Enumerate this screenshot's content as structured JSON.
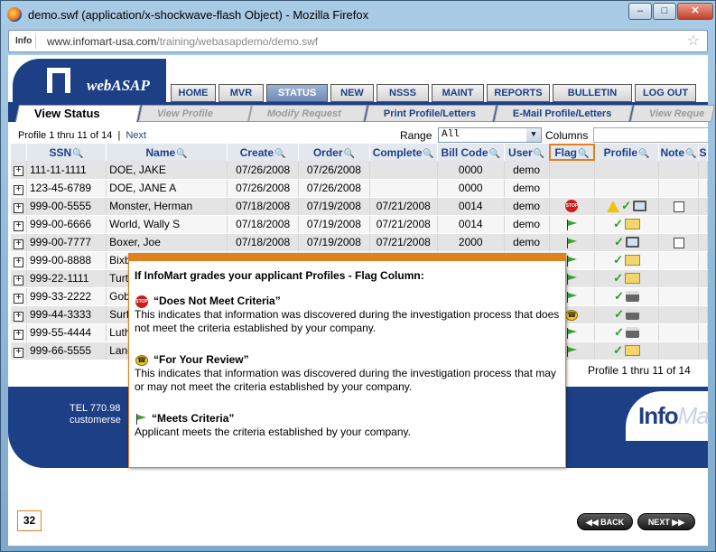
{
  "window": {
    "title": "demo.swf (application/x-shockwave-flash Object) - Mozilla Firefox"
  },
  "address": {
    "badge": "Info",
    "domain": "www.infomart-usa.com",
    "path": "/training/webasapdemo/demo.swf"
  },
  "logo": {
    "text": "webASAP"
  },
  "nav": [
    "HOME",
    "MVR",
    "STATUS",
    "NEW",
    "NSSS",
    "MAINT",
    "REPORTS",
    "BULLETIN",
    "LOG OUT"
  ],
  "tabs": [
    "View Status",
    "View Profile",
    "Modify Request",
    "Print Profile/Letters",
    "E-Mail Profile/Letters",
    "View Reque"
  ],
  "infobar": {
    "summary": "Profile 1 thru 11 of 14",
    "next": "Next",
    "range_label": "Range",
    "range_value": "All",
    "columns_label": "Columns"
  },
  "columns": [
    "SSN",
    "Name",
    "Create",
    "Order",
    "Complete",
    "Bill Code",
    "User",
    "Flag",
    "Profile",
    "Note",
    "S"
  ],
  "rows": [
    {
      "ssn": "111-11-1111",
      "name": "DOE, JAKE",
      "create": "07/26/2008",
      "order": "07/26/2008",
      "complete": "",
      "bill": "0000",
      "user": "demo",
      "flag": "",
      "profile": "",
      "note": ""
    },
    {
      "ssn": "123-45-6789",
      "name": "DOE, JANE A",
      "create": "07/26/2008",
      "order": "07/26/2008",
      "complete": "",
      "bill": "0000",
      "user": "demo",
      "flag": "",
      "profile": "",
      "note": ""
    },
    {
      "ssn": "999-00-5555",
      "name": "Monster, Herman",
      "create": "07/18/2008",
      "order": "07/19/2008",
      "complete": "07/21/2008",
      "bill": "0014",
      "user": "demo",
      "flag": "stop",
      "profile": "warn-check-monitor",
      "note": "note"
    },
    {
      "ssn": "999-00-6666",
      "name": "World, Wally S",
      "create": "07/18/2008",
      "order": "07/19/2008",
      "complete": "07/21/2008",
      "bill": "0014",
      "user": "demo",
      "flag": "green",
      "profile": "check-folder",
      "note": ""
    },
    {
      "ssn": "999-00-7777",
      "name": "Boxer, Joe",
      "create": "07/18/2008",
      "order": "07/19/2008",
      "complete": "07/21/2008",
      "bill": "2000",
      "user": "demo",
      "flag": "green",
      "profile": "check-monitor",
      "note": "note"
    },
    {
      "ssn": "999-00-8888",
      "name": "Bixb",
      "create": "",
      "order": "",
      "complete": "",
      "bill": "",
      "user": "",
      "flag": "green",
      "profile": "check-folder",
      "note": ""
    },
    {
      "ssn": "999-22-1111",
      "name": "Turt",
      "create": "",
      "order": "",
      "complete": "",
      "bill": "",
      "user": "",
      "flag": "green",
      "profile": "check-folder",
      "note": ""
    },
    {
      "ssn": "999-33-2222",
      "name": "Gob",
      "create": "",
      "order": "",
      "complete": "",
      "bill": "",
      "user": "",
      "flag": "green",
      "profile": "check-printer",
      "note": ""
    },
    {
      "ssn": "999-44-3333",
      "name": "Surf",
      "create": "",
      "order": "",
      "complete": "",
      "bill": "",
      "user": "",
      "flag": "yellow",
      "profile": "check-printer",
      "note": ""
    },
    {
      "ssn": "999-55-4444",
      "name": "Luth",
      "create": "",
      "order": "",
      "complete": "",
      "bill": "",
      "user": "",
      "flag": "green",
      "profile": "check-printer",
      "note": ""
    },
    {
      "ssn": "999-66-5555",
      "name": "Lane",
      "create": "",
      "order": "",
      "complete": "",
      "bill": "",
      "user": "",
      "flag": "green",
      "profile": "check-folder",
      "note": ""
    }
  ],
  "bottom_summary": "Profile 1 thru 11 of 14",
  "footer": {
    "tel": "TEL 770.98",
    "email": "customerse",
    "brand": "Info",
    "brand_tail": "Ma"
  },
  "popup": {
    "heading": "If InfoMart grades your applicant Profiles - Flag Column:",
    "stop_title": "“Does Not Meet Criteria”",
    "stop_text": "This indicates that information was discovered during the investigation process that does not meet the criteria established by your company.",
    "review_title": "“For Your Review”",
    "review_text": "This indicates that information was discovered during the investigation process that may or may not meet the criteria established by your company.",
    "meets_title": "“Meets Criteria”",
    "meets_text": "Applicant meets the criteria established by your company."
  },
  "page_number": "32",
  "buttons": {
    "back": "BACK",
    "next": "NEXT"
  },
  "colors": {
    "navy": "#1c3f85",
    "orange": "#e3801e"
  },
  "icons": [
    "firefox-icon",
    "star-icon",
    "magnifier-icon",
    "stop-icon",
    "green-flag-icon",
    "yellow-flag-icon",
    "check-icon",
    "warning-icon",
    "monitor-icon",
    "folder-icon",
    "printer-icon",
    "note-icon"
  ]
}
